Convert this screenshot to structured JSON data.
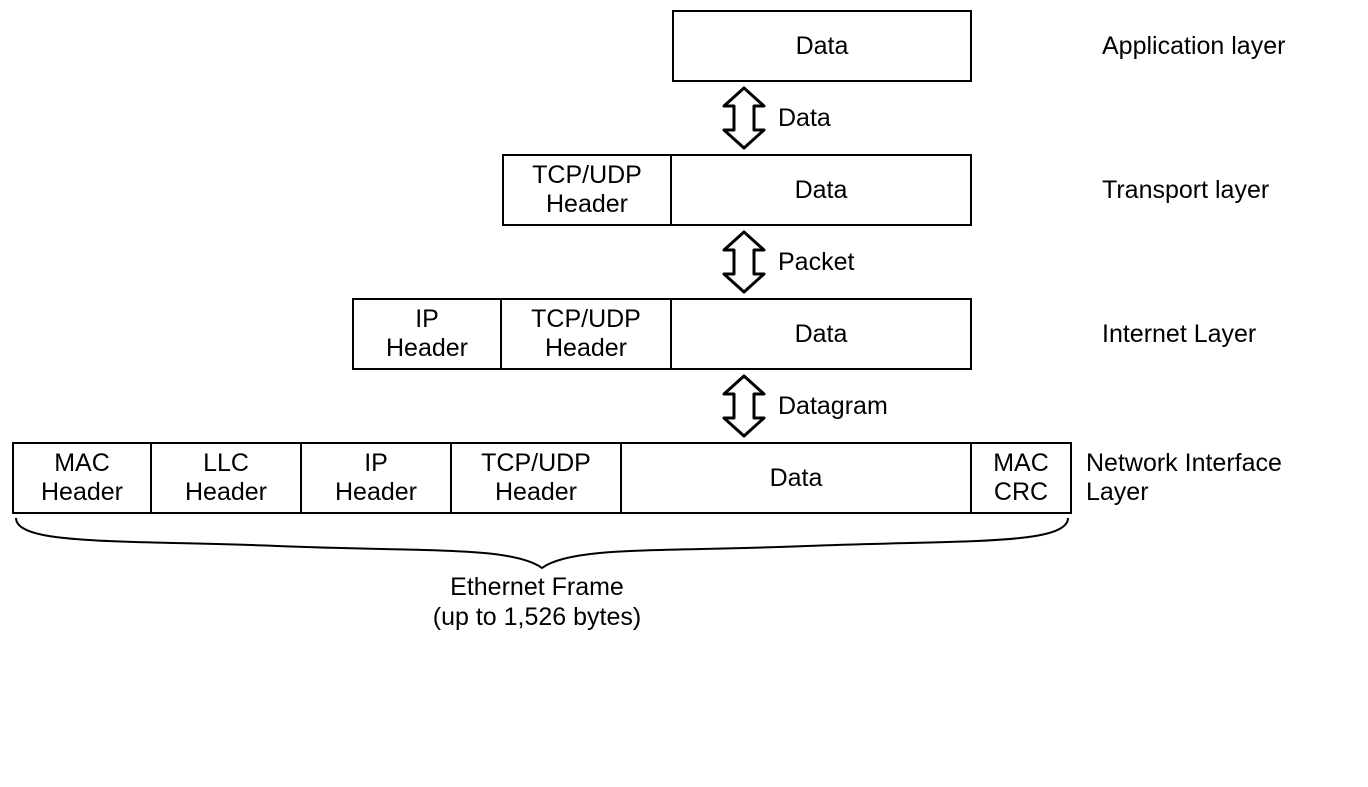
{
  "layers": {
    "application": {
      "label": "Application layer",
      "cells": [
        "Data"
      ]
    },
    "transport": {
      "label": "Transport layer",
      "cells": [
        "TCP/UDP\nHeader",
        "Data"
      ]
    },
    "internet": {
      "label": "Internet Layer",
      "cells": [
        "IP\nHeader",
        "TCP/UDP\nHeader",
        "Data"
      ]
    },
    "network_interface": {
      "label": "Network Interface\nLayer",
      "cells": [
        "MAC\nHeader",
        "LLC\nHeader",
        "IP\nHeader",
        "TCP/UDP\nHeader",
        "Data",
        "MAC\nCRC"
      ]
    }
  },
  "arrows": {
    "a1": "Data",
    "a2": "Packet",
    "a3": "Datagram"
  },
  "brace": {
    "caption": "Ethernet Frame\n(up to 1,526 bytes)"
  }
}
